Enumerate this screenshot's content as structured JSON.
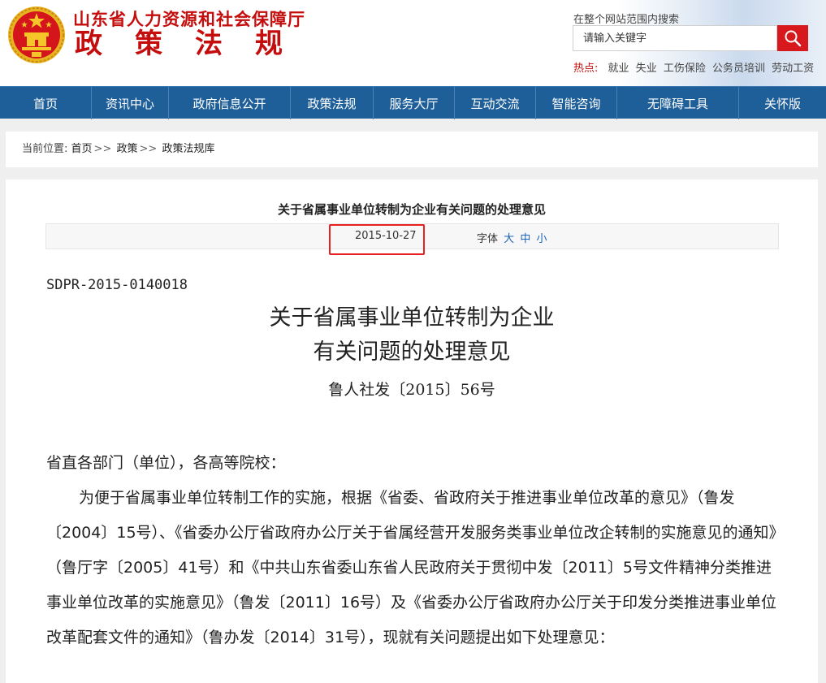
{
  "header": {
    "site_name": "山东省人力资源和社会保障厅",
    "section_name": "政策法规",
    "search_caption": "在整个网站范围内搜索",
    "search_placeholder": "请输入关键字",
    "hot_label": "热点:",
    "hot_links": [
      "就业",
      "失业",
      "工伤保险",
      "公务员培训",
      "劳动工资"
    ]
  },
  "nav": {
    "items": [
      {
        "label": "首页",
        "width": 113
      },
      {
        "label": "资讯中心",
        "width": 95
      },
      {
        "label": "政府信息公开",
        "width": 150
      },
      {
        "label": "政策法规",
        "width": 102
      },
      {
        "label": "服务大厅",
        "width": 100
      },
      {
        "label": "互动交流",
        "width": 100
      },
      {
        "label": "智能咨询",
        "width": 100
      },
      {
        "label": "无障碍工具",
        "width": 150
      },
      {
        "label": "关怀版",
        "width": 107
      }
    ]
  },
  "breadcrumb": {
    "prefix": "当前位置:",
    "items": [
      "首页",
      "政策",
      "政策法规库"
    ],
    "separator": ">>"
  },
  "article": {
    "title": "关于省属事业单位转制为企业有关问题的处理意见",
    "date": "2015-10-27",
    "font_label": "字体",
    "font_sizes": [
      "大",
      "中",
      "小"
    ],
    "doc_code": "SDPR-2015-0140018",
    "doc_title_line1": "关于省属事业单位转制为企业",
    "doc_title_line2": "有关问题的处理意见",
    "doc_number": "鲁人社发〔2015〕56号",
    "salutation": "省直各部门（单位），各高等院校：",
    "paragraph1": "为便于省属事业单位转制工作的实施，根据《省委、省政府关于推进事业单位改革的意见》（鲁发〔2004〕15号）、《省委办公厅省政府办公厅关于省属经营开发服务类事业单位改企转制的实施意见的通知》（鲁厅字〔2005〕41号）和《中共山东省委山东省人民政府关于贯彻中发〔2011〕5号文件精神分类推进事业单位改革的实施意见》（鲁发〔2011〕16号）及《省委办公厅省政府办公厅关于印发分类推进事业单位改革配套文件的通知》（鲁办发〔2014〕31号），现就有关问题提出如下处理意见："
  },
  "colors": {
    "brand_red": "#c40d0d",
    "nav_blue": "#1f5f99",
    "search_red": "#d7191d",
    "highlight_red": "#e8201f",
    "link_blue": "#1a63b6"
  }
}
